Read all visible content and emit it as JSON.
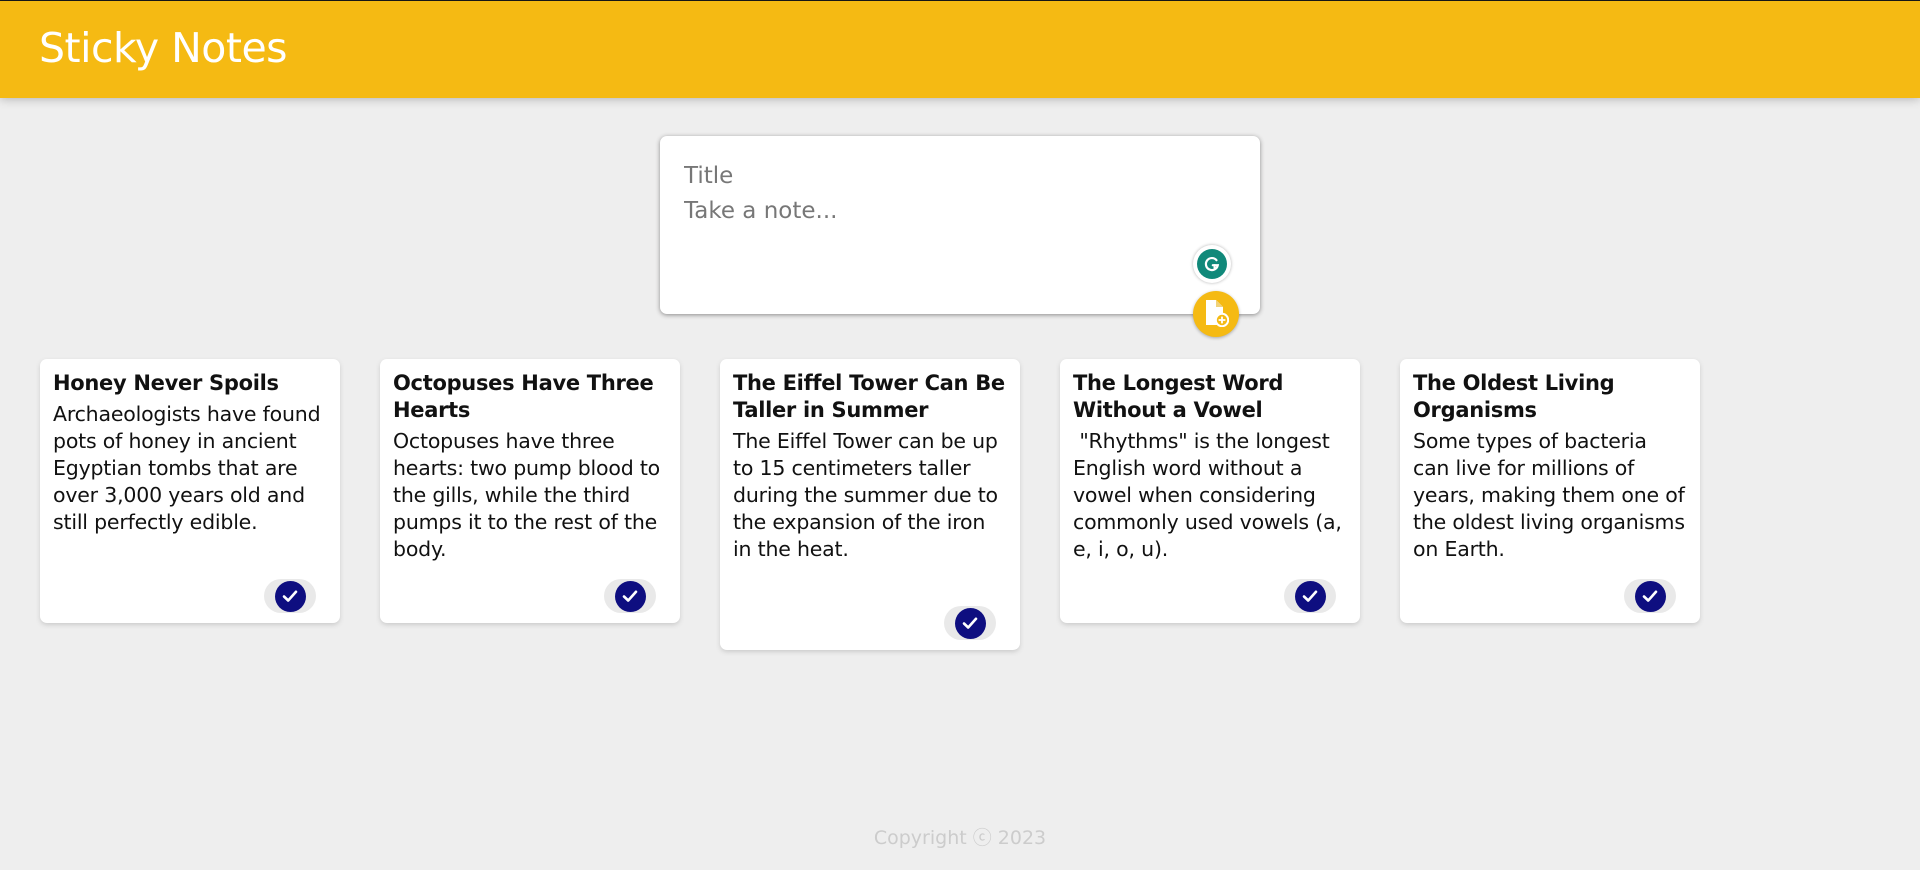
{
  "header": {
    "title": "Sticky Notes"
  },
  "create_note": {
    "title_placeholder": "Title",
    "content_placeholder": "Take a note..."
  },
  "notes": [
    {
      "title": "Honey Never Spoils",
      "content": "Archaeologists have found pots of honey in ancient Egyptian tombs that are over 3,000 years old and still perfectly edible."
    },
    {
      "title": "Octopuses Have Three Hearts",
      "content": "Octopuses have three hearts: two pump blood to the gills, while the third pumps it to the rest of the body."
    },
    {
      "title": "The Eiffel Tower Can Be Taller in Summer",
      "content": "The Eiffel Tower can be up to 15 centimeters taller during the summer due to the expansion of the iron in the heat."
    },
    {
      "title": "The Longest Word Without a Vowel",
      "content": " \"Rhythms\" is the longest English word without a vowel when considering commonly used vowels (a, e, i, o, u)."
    },
    {
      "title": "The Oldest Living Organisms",
      "content": "Some types of bacteria can live for millions of years, making them one of the oldest living organisms on Earth."
    }
  ],
  "footer": {
    "text": "Copyright ⓒ 2023"
  },
  "colors": {
    "brand": "#f5ba13",
    "background": "#eeeeee",
    "done_button": "#0e0e80",
    "grammarly": "#11897a"
  },
  "icons": {
    "add": "note-add-icon",
    "done": "check-icon",
    "grammarly": "grammarly-icon"
  }
}
